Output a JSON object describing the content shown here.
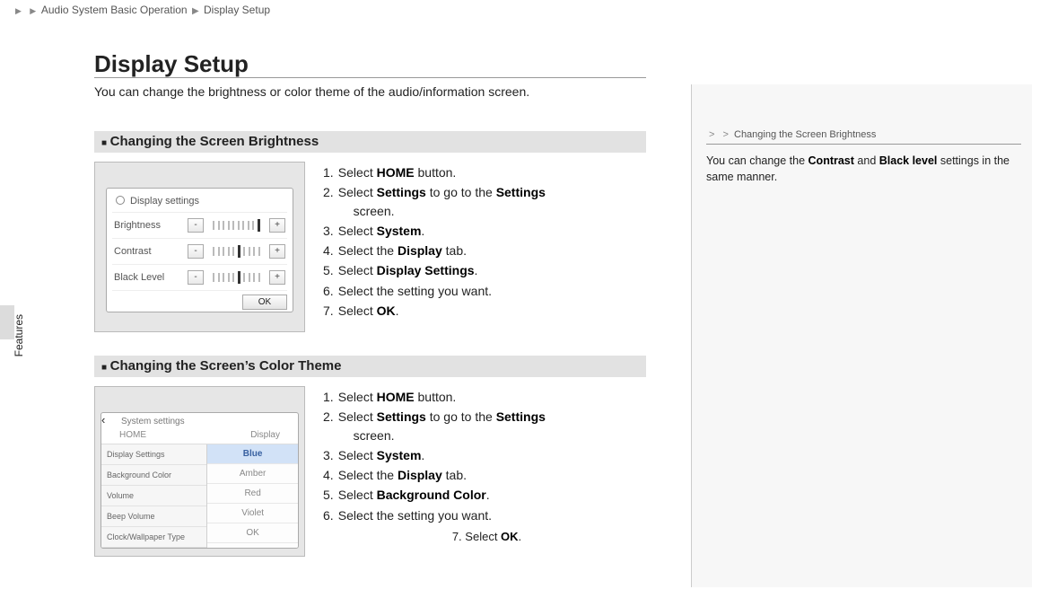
{
  "breadcrumb": {
    "part1": "Audio System Basic Operation",
    "part2": "Display Setup"
  },
  "pageTitle": "Display Setup",
  "intro": "You can change the brightness or color theme of the audio/information screen.",
  "sideTab": "Features",
  "section1": {
    "title": "Changing the Screen Brightness",
    "shot": {
      "header": "Display settings",
      "rows": [
        {
          "label": "Brightness",
          "activeIdx": 9
        },
        {
          "label": "Contrast",
          "activeIdx": 5
        },
        {
          "label": "Black Level",
          "activeIdx": 5
        }
      ],
      "ok": "OK"
    },
    "steps": [
      {
        "n": "1.",
        "pre": "Select ",
        "b1": "HOME",
        "post": " button."
      },
      {
        "n": "2.",
        "pre": "Select ",
        "b1": "Settings",
        "mid": " to go to the ",
        "b2": "Settings",
        "post2": "screen."
      },
      {
        "n": "3.",
        "pre": "Select ",
        "b1": "System",
        "post": "."
      },
      {
        "n": "4.",
        "pre": "Select the ",
        "b1": "Display",
        "post": " tab."
      },
      {
        "n": "5.",
        "pre": "Select ",
        "b1": "Display Settings",
        "post": "."
      },
      {
        "n": "6.",
        "pre": "Select the setting you want."
      },
      {
        "n": "7.",
        "pre": "Select ",
        "b1": "OK",
        "post": "."
      }
    ]
  },
  "section2": {
    "title": "Changing the Screen’s Color Theme",
    "shot": {
      "header": "System settings",
      "tabs": {
        "left": "HOME",
        "right": "Display"
      },
      "leftList": [
        "Display Settings",
        "Background Color",
        "Volume",
        "Beep Volume",
        "Clock/Wallpaper Type"
      ],
      "rightList": [
        "Blue",
        "Amber",
        "Red",
        "Violet",
        "OK"
      ]
    },
    "steps": [
      {
        "n": "1.",
        "pre": "Select ",
        "b1": "HOME",
        "post": " button."
      },
      {
        "n": "2.",
        "pre": "Select ",
        "b1": "Settings",
        "mid": " to go to the ",
        "b2": "Settings",
        "post2": "screen."
      },
      {
        "n": "3.",
        "pre": "Select ",
        "b1": "System",
        "post": "."
      },
      {
        "n": "4.",
        "pre": "Select the ",
        "b1": "Display",
        "post": " tab."
      },
      {
        "n": "5.",
        "pre": "Select ",
        "b1": "Background Color",
        "post": "."
      },
      {
        "n": "6.",
        "pre": "Select the setting you want."
      }
    ],
    "step7": {
      "n": "7.",
      "pre": "Select ",
      "b1": "OK",
      "post": "."
    }
  },
  "sidenote": {
    "crumb": "Changing the Screen Brightness",
    "text_a": "You can change the ",
    "b1": "Contrast",
    "text_b": " and ",
    "b2": "Black level",
    "text_c": " settings in the same manner."
  }
}
